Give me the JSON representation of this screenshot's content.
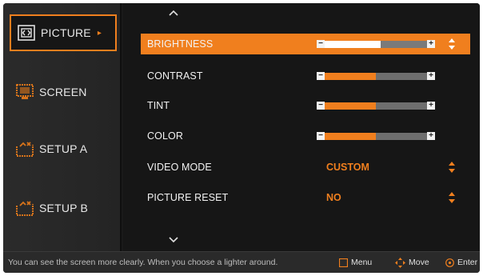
{
  "menu": {
    "items": [
      {
        "label": "PICTURE",
        "icon": "picture-icon",
        "active": true
      },
      {
        "label": "SCREEN",
        "icon": "screen-icon",
        "active": false
      },
      {
        "label": "SETUP A",
        "icon": "setup-a-icon",
        "active": false
      },
      {
        "label": "SETUP B",
        "icon": "setup-b-icon",
        "active": false
      }
    ],
    "active_marker": "▸"
  },
  "settings": {
    "brightness": {
      "label": "BRIGHTNESS",
      "level": 0.55,
      "selected": true
    },
    "contrast": {
      "label": "CONTRAST",
      "level": 0.5,
      "selected": false
    },
    "tint": {
      "label": "TINT",
      "level": 0.5,
      "selected": false
    },
    "color": {
      "label": "COLOR",
      "level": 0.5,
      "selected": false
    },
    "video_mode": {
      "label": "VIDEO MODE",
      "value": "CUSTOM"
    },
    "picture_reset": {
      "label": "PICTURE RESET",
      "value": "NO"
    },
    "slider_minus": "−",
    "slider_plus": "+"
  },
  "footer": {
    "hint": "You can see the screen more clearly.  When you choose a lighter around.",
    "menu_label": "Menu",
    "move_label": "Move",
    "enter_label": "Enter"
  },
  "colors": {
    "accent": "#f07f1e",
    "background": "#1a1a1a",
    "text": "#f2f2f2"
  }
}
